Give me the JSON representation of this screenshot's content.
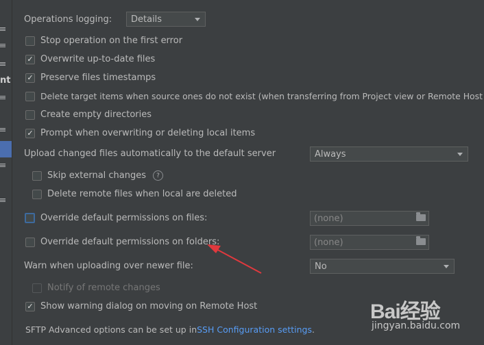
{
  "sidebar": {
    "partial_label": "nt"
  },
  "operations_logging": {
    "label": "Operations logging:",
    "value": "Details"
  },
  "options": {
    "stop_on_error": "Stop operation on the first error",
    "overwrite_up_to_date": "Overwrite up-to-date files",
    "preserve_timestamps": "Preserve files timestamps",
    "delete_target_items": "Delete target items when source ones do not exist (when transferring from Project view or Remote Host view)",
    "create_empty_dirs": "Create empty directories",
    "prompt_overwriting": "Prompt when overwriting or deleting local items"
  },
  "upload": {
    "label": "Upload changed files automatically to the default server",
    "value": "Always"
  },
  "skip_external": {
    "label": "Skip external changes",
    "help": "?"
  },
  "delete_remote": "Delete remote files when local are deleted",
  "override_files": {
    "label": "Override default permissions on files:",
    "value": "(none)"
  },
  "override_folders": {
    "label": "Override default permissions on folders:",
    "value": "(none)"
  },
  "warn_uploading": {
    "label": "Warn when uploading over newer file:",
    "value": "No"
  },
  "notify_remote": "Notify of remote changes",
  "show_warning_dialog": "Show warning dialog on moving on Remote Host",
  "footer": {
    "text": "SFTP Advanced options can be set up in ",
    "link": "SSH Configuration settings",
    "period": "."
  },
  "watermark": {
    "logo": "Bai经验",
    "sub": "jingyan.baidu.com"
  },
  "colors": {
    "background": "#3c3f41",
    "link": "#589df6",
    "arrow": "#e0393e",
    "accent": "#4b6eaf"
  }
}
